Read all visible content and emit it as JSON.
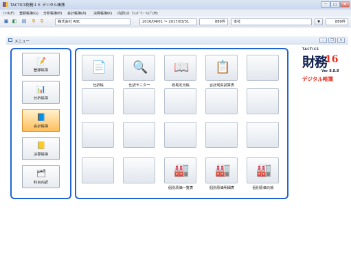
{
  "window": {
    "title": "TACTICS財務１６ デジタル帳簿",
    "controls": {
      "minimize": "－",
      "maximize": "□",
      "close": "✕"
    }
  },
  "menubar": {
    "items": [
      "ﾌｧｲﾙ(F)",
      "登録帳簿(G)",
      "分析帳簿(B)",
      "会計帳簿(A)",
      "決算帳簿(K)",
      "内訳(U)",
      "ｳｨﾝﾄﾞｳ・ﾍﾙﾌﾟ(H)"
    ]
  },
  "toolbar": {
    "company": "株式会社 ABC",
    "period": "2016/04/01 〜 2017/03/31",
    "count": "889件",
    "office": "本社",
    "right_count": "889件",
    "dropdown_glyph": "▼"
  },
  "menu_window": {
    "title": "メニュー",
    "controls": {
      "minimize": "－",
      "restore": "❐",
      "close": "✕"
    }
  },
  "categories": [
    {
      "label": "登録帳簿",
      "icon": "register-book-icon",
      "glyph": "📝",
      "active": false
    },
    {
      "label": "分析帳簿",
      "icon": "analysis-chart-icon",
      "glyph": "📊",
      "active": false
    },
    {
      "label": "会計帳簿",
      "icon": "accounting-book-icon",
      "glyph": "📘",
      "active": true
    },
    {
      "label": "決算帳簿",
      "icon": "settlement-book-icon",
      "glyph": "📒",
      "active": false
    },
    {
      "label": "科目内訳",
      "icon": "account-breakdown-icon",
      "glyph": "🗂",
      "active": false
    }
  ],
  "tiles": [
    [
      {
        "label": "仕訳帳",
        "glyph": "📄",
        "icon": "journal-icon"
      },
      {
        "label": "仕訳モニター",
        "glyph": "🔍",
        "icon": "journal-monitor-icon"
      },
      {
        "label": "総勘定元帳",
        "glyph": "📖",
        "icon": "general-ledger-icon"
      },
      {
        "label": "合計残高試算表",
        "glyph": "📋",
        "icon": "trial-balance-icon"
      },
      {
        "label": "",
        "glyph": "",
        "icon": ""
      }
    ],
    [
      {
        "label": "",
        "glyph": "",
        "icon": ""
      },
      {
        "label": "",
        "glyph": "",
        "icon": ""
      },
      {
        "label": "",
        "glyph": "",
        "icon": ""
      },
      {
        "label": "",
        "glyph": "",
        "icon": ""
      },
      {
        "label": "",
        "glyph": "",
        "icon": ""
      }
    ],
    [
      {
        "label": "",
        "glyph": "",
        "icon": ""
      },
      {
        "label": "",
        "glyph": "",
        "icon": ""
      },
      {
        "label": "",
        "glyph": "",
        "icon": ""
      },
      {
        "label": "",
        "glyph": "",
        "icon": ""
      },
      {
        "label": "",
        "glyph": "",
        "icon": ""
      }
    ],
    [
      {
        "label": "",
        "glyph": "",
        "icon": ""
      },
      {
        "label": "",
        "glyph": "",
        "icon": ""
      },
      {
        "label": "個別原価一覧表",
        "glyph": "🏭",
        "icon": "cost-list-icon"
      },
      {
        "label": "個別原価明細表",
        "glyph": "🏭",
        "icon": "cost-detail-icon"
      },
      {
        "label": "個別原価元帳",
        "glyph": "🏭",
        "icon": "cost-ledger-icon"
      }
    ]
  ],
  "brand": {
    "small": "TACTICS",
    "main": "財務",
    "number": "16",
    "version": "Ver 8.8.8",
    "subtitle": "デジタル帳簿"
  },
  "colors": {
    "panel_border": "#1f63d6",
    "active_category": "#ffbd5a",
    "brand_red": "#e62d1f"
  }
}
